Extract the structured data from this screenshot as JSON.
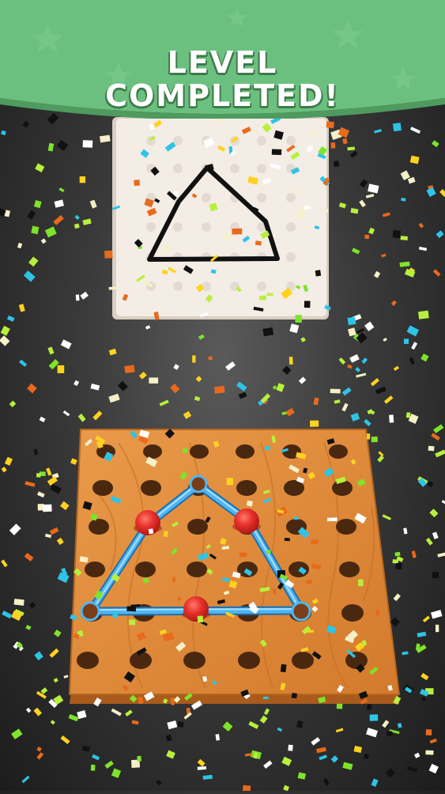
{
  "banner": {
    "line1": "LEVEL",
    "line2": "COMPLETED!",
    "color": "#6cc07f"
  },
  "colors": {
    "board_wood": "#e08a3c",
    "rubber_band": "#3fa7e8",
    "peg_red": "#e8322b",
    "target_card": "#f3ece4"
  },
  "target": {
    "shape": "quadrilateral",
    "grid": "6x6"
  },
  "board": {
    "grid": "6x6",
    "shape": "quadrilateral",
    "red_pegs": 3
  },
  "effect": "confetti"
}
